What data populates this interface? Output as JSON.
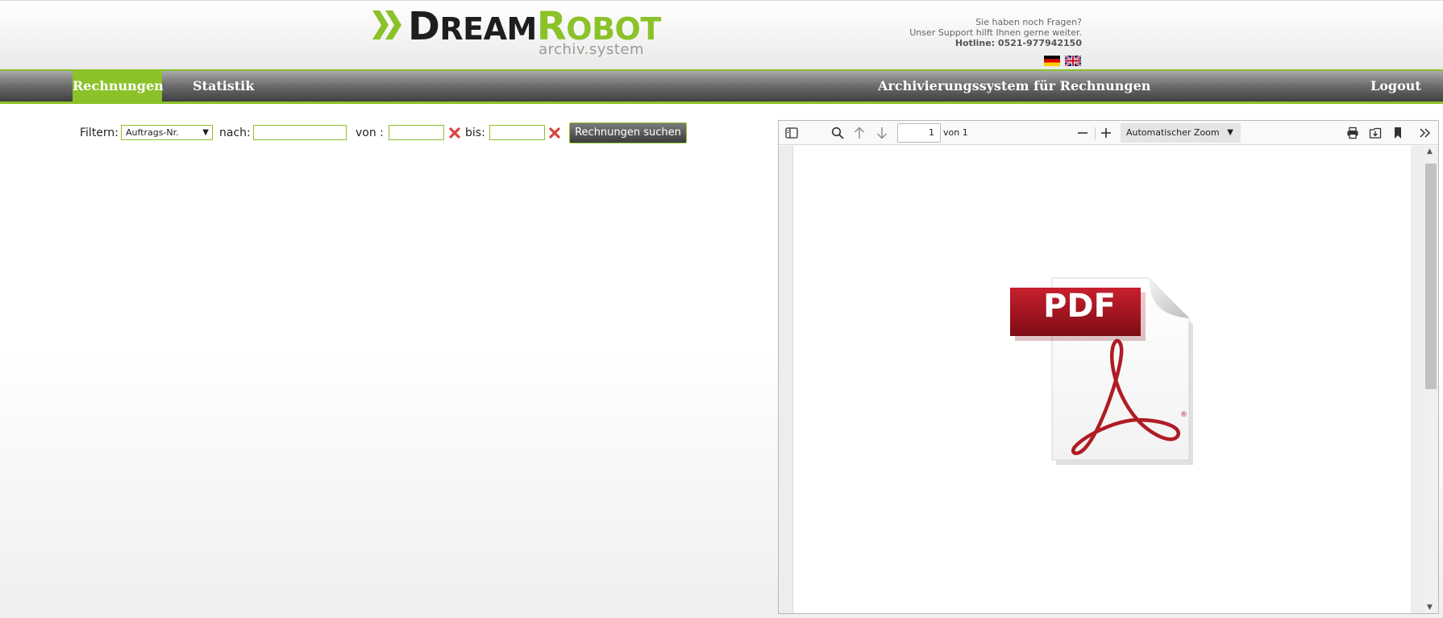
{
  "brand": {
    "logo_main_first": "D",
    "logo_main_mid": "REAM",
    "logo_main_r": "R",
    "logo_main_end": "OBOT",
    "logo_sub_a": "archiv",
    "logo_sub_dot": ".",
    "logo_sub_b": "system",
    "accent_color": "#8cc229"
  },
  "support": {
    "line1": "Sie haben noch Fragen?",
    "line2": "Unser Support hilft Ihnen gerne weiter.",
    "hotline": "Hotline: 0521-977942150"
  },
  "languages": [
    "de",
    "en"
  ],
  "nav": {
    "items": [
      {
        "label": "Rechnungen",
        "active": true
      },
      {
        "label": "Statistik",
        "active": false
      }
    ],
    "title": "Archivierungssystem für Rechnungen",
    "logout": "Logout"
  },
  "filter": {
    "label": "Filtern:",
    "selected": "Auftrags-Nr.",
    "nach_label": "nach:",
    "nach_value": "",
    "von_label": "von :",
    "von_value": "",
    "bis_label": "bis:",
    "bis_value": "",
    "search_button": "Rechnungen suchen"
  },
  "viewer": {
    "page_number": "1",
    "page_of": "von 1",
    "zoom": "Automatischer Zoom",
    "pdf_label": "PDF"
  }
}
